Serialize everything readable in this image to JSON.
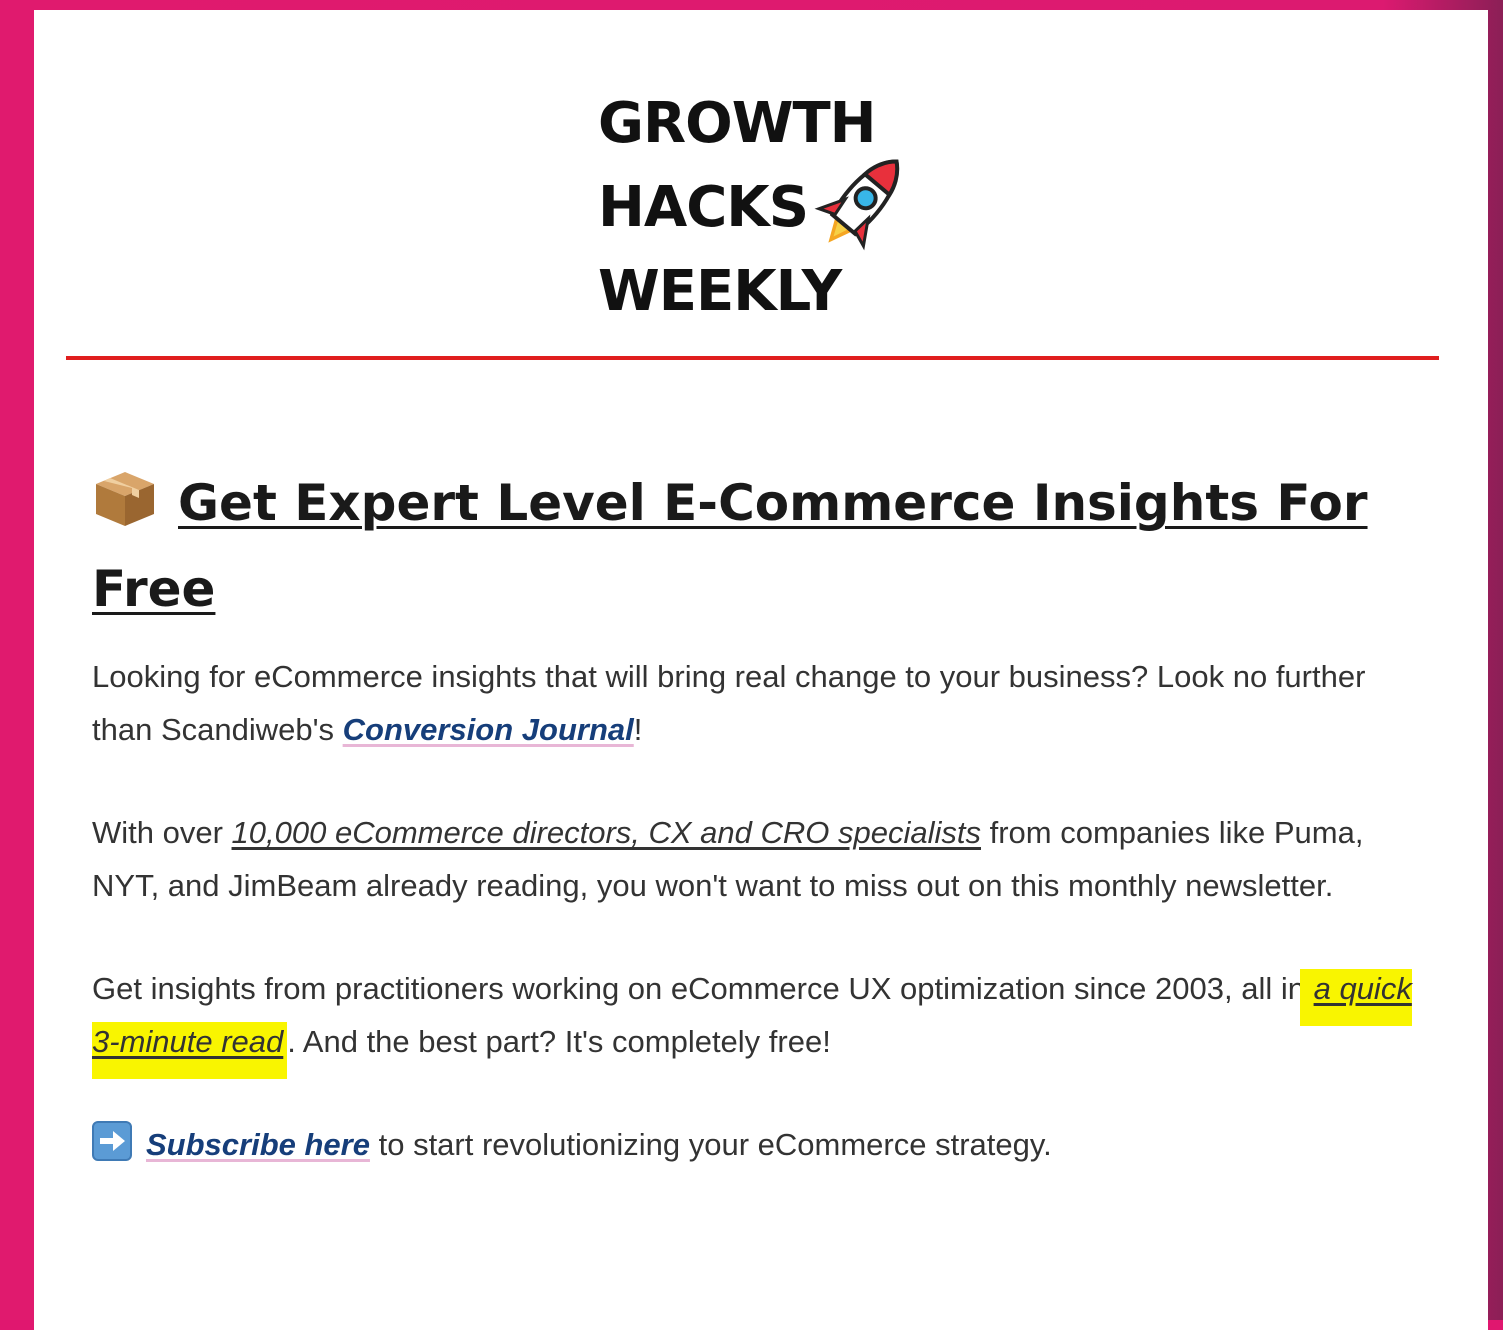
{
  "newsletter": {
    "logo_line_1": "GROWTH",
    "logo_line_2": "HACKS",
    "logo_line_3": "WEEKLY",
    "logo_icon": "rocket-icon"
  },
  "headline": {
    "icon": "package-icon",
    "text": "Get Expert Level E-Commerce Insights For Free"
  },
  "paragraph_1": {
    "text_before": "Looking for eCommerce insights that will bring real change to your business? Look no further than Scandiweb's ",
    "link_text": "Conversion Journal",
    "text_after": "!"
  },
  "paragraph_2": {
    "text_before": "With over ",
    "link_text": "10,000 eCommerce directors, CX and CRO specialists",
    "text_after": " from companies like Puma, NYT, and JimBeam already reading, you won't want to miss out on this monthly newsletter."
  },
  "paragraph_3": {
    "text_before": "Get insights from practitioners working on eCommerce UX optimization since 2003, all in ",
    "link_text": "a quick 3-minute read",
    "text_after": ". And the best part? It's completely free!"
  },
  "cta": {
    "icon": "right-arrow-icon",
    "link_text": "Subscribe here",
    "text_after": " to start revolutionizing your eCommerce strategy."
  },
  "colors": {
    "frame": "#e0176f",
    "divider": "#e01e1e",
    "link": "#163e7a",
    "highlight": "#f9f500"
  }
}
